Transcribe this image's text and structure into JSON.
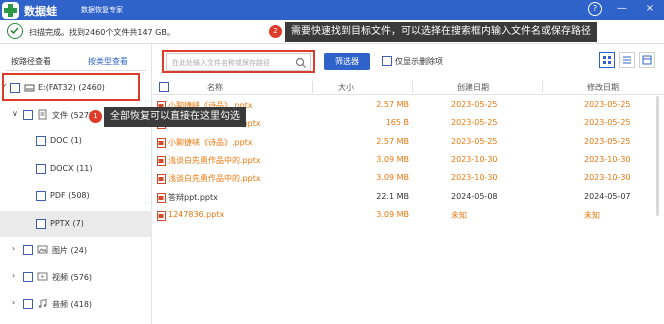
{
  "app": {
    "name": "数据蛙",
    "subtitle": "数据恢复专家",
    "help_symbol": "?",
    "min_symbol": "—",
    "close_symbol": "×"
  },
  "status": {
    "text": "扫描完成。找到2460个文件共147 GB。"
  },
  "callouts": {
    "one": {
      "number": "1",
      "text": "全部恢复可以直接在这里勾选"
    },
    "two": {
      "number": "2",
      "text": "需要快速找到目标文件，可以选择在搜索框内输入文件名或保存路径"
    }
  },
  "sidebar": {
    "tab_path": "按路径查看",
    "tab_type": "按类型查看",
    "tree": [
      {
        "label": "E:(FAT32) (2460)",
        "icon": "drive-icon",
        "chevron": "✓"
      },
      {
        "label": "文件 (527)",
        "icon": "document-icon",
        "chevron": "∨"
      },
      {
        "label": "DOC (1)"
      },
      {
        "label": "DOCX (11)"
      },
      {
        "label": "PDF (508)"
      },
      {
        "label": "PPTX (7)"
      },
      {
        "label": "图片 (24)",
        "icon": "picture-icon",
        "chevron": "›"
      },
      {
        "label": "视频 (576)",
        "icon": "video-icon",
        "chevron": "›"
      },
      {
        "label": "音频 (418)",
        "icon": "music-icon",
        "chevron": "›"
      }
    ]
  },
  "toolbar": {
    "search_placeholder": "在此处输入文件名称或保存路径",
    "filter_label": "筛选器",
    "only_deleted_label": "仅显示删除项"
  },
  "table": {
    "headers": {
      "name": "名称",
      "size": "大小",
      "created": "创建日期",
      "modified": "修改日期"
    },
    "rows": [
      {
        "name": "小聊捷峡《诗品》.pptx",
        "size": "2.57 MB",
        "created": "2023-05-25",
        "modified": "2023-05-25",
        "color": "orange",
        "icon": "pptx-deleted"
      },
      {
        "name": "浅谈白先勇作品中的.pptx",
        "size": "165 B",
        "created": "2023-05-25",
        "modified": "2023-05-25",
        "color": "orange",
        "icon": "pptx-deleted"
      },
      {
        "name": "小聊捷峡《诗品》.pptx",
        "size": "2.57 MB",
        "created": "2023-05-25",
        "modified": "2023-05-25",
        "color": "orange",
        "icon": "pptx-deleted"
      },
      {
        "name": "浅谈白先勇作品中的.pptx",
        "size": "3.09 MB",
        "created": "2023-10-30",
        "modified": "2023-10-30",
        "color": "orange",
        "icon": "pptx-deleted"
      },
      {
        "name": "浅谈白先勇作品中的.pptx",
        "size": "3.09 MB",
        "created": "2023-10-30",
        "modified": "2023-10-30",
        "color": "orange",
        "icon": "pptx-deleted"
      },
      {
        "name": "答辩ppt.pptx",
        "size": "22.1 MB",
        "created": "2024-05-08",
        "modified": "2024-05-07",
        "color": "dark",
        "icon": "pptx"
      },
      {
        "name": "1247836.pptx",
        "size": "3.09 MB",
        "created": "未知",
        "modified": "未知",
        "color": "orange",
        "icon": "pptx-deleted"
      }
    ]
  },
  "colors": {
    "brand": "#2f63c9",
    "deleted_text": "#e8780d",
    "highlight_red": "#e03a2a"
  }
}
